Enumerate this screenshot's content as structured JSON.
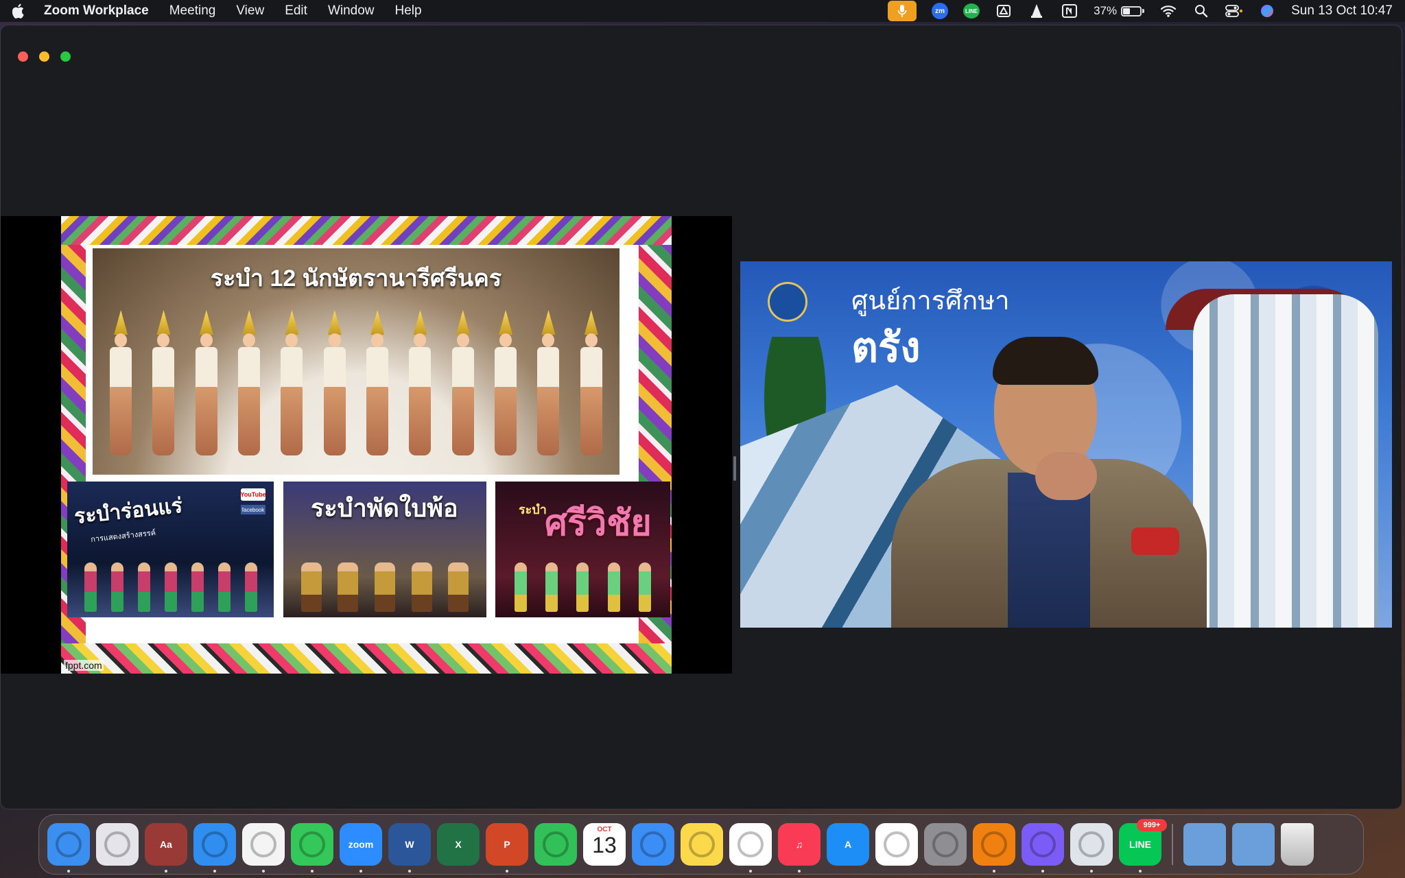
{
  "menubar": {
    "app_name": "Zoom Workplace",
    "menus": [
      "Meeting",
      "View",
      "Edit",
      "Window",
      "Help"
    ],
    "status_icons": [
      "microphone-icon",
      "zoom-icon",
      "line-icon",
      "google-drive-icon",
      "vlc-icon",
      "notion-icon"
    ],
    "battery_percent": "37%",
    "battery_level": 0.37,
    "clock": "Sun 13 Oct  10:47"
  },
  "window": {
    "traffic_lights": [
      "close",
      "minimize",
      "zoom"
    ]
  },
  "shared_screen": {
    "slide_title": "ระบำ 12 นักษัตรานารีศรีนคร",
    "thumbnails": [
      {
        "title": "ระบำร่อนแร่",
        "subtitle": "การแสดงสร้างสรรค์",
        "badges": [
          "YouTube",
          "facebook"
        ]
      },
      {
        "title": "ระบำพัดใบพ้อ"
      },
      {
        "pre": "ระบำ",
        "title": "ศรีวิชัย"
      }
    ],
    "credit": "fppt.com"
  },
  "video": {
    "heading": "ศูนย์การศึกษา",
    "heading2": "ตรัง"
  },
  "dock": {
    "apps": [
      {
        "name": "Finder",
        "icon": "finder-icon",
        "running": true,
        "color": "#3b8ff0"
      },
      {
        "name": "Launchpad",
        "icon": "launchpad-icon",
        "running": false,
        "color": "#e4e4ea"
      },
      {
        "name": "Dictionary",
        "icon": "dictionary-icon",
        "running": true,
        "color": "#9a3a36",
        "label": "Aa"
      },
      {
        "name": "Safari",
        "icon": "safari-icon",
        "running": true,
        "color": "#2f8ef0"
      },
      {
        "name": "Chrome",
        "icon": "chrome-icon",
        "running": true,
        "color": "#f4f4f4"
      },
      {
        "name": "Messages",
        "icon": "messages-icon",
        "running": true,
        "color": "#34c759"
      },
      {
        "name": "Zoom",
        "icon": "zoom-app-icon",
        "running": true,
        "color": "#2d8cff",
        "label": "zoom"
      },
      {
        "name": "Word",
        "icon": "word-icon",
        "running": true,
        "color": "#2b579a",
        "label": "W"
      },
      {
        "name": "Excel",
        "icon": "excel-icon",
        "running": false,
        "color": "#217346",
        "label": "X"
      },
      {
        "name": "PowerPoint",
        "icon": "powerpoint-icon",
        "running": true,
        "color": "#d24726",
        "label": "P"
      },
      {
        "name": "FaceTime",
        "icon": "facetime-icon",
        "running": false,
        "color": "#32c059"
      },
      {
        "name": "Calendar",
        "icon": "calendar-icon",
        "running": false,
        "color": "#ffffff",
        "month": "OCT",
        "day": "13"
      },
      {
        "name": "Mail",
        "icon": "mail-icon",
        "running": false,
        "color": "#3a8ef6"
      },
      {
        "name": "Notes",
        "icon": "notes-icon",
        "running": false,
        "color": "#fbd94a"
      },
      {
        "name": "Freeform",
        "icon": "freeform-icon",
        "running": true,
        "color": "#ffffff"
      },
      {
        "name": "Music",
        "icon": "music-icon",
        "running": true,
        "color": "#fa3b55",
        "label": "♫"
      },
      {
        "name": "App Store",
        "icon": "appstore-icon",
        "running": false,
        "color": "#1c8ef5",
        "label": "A"
      },
      {
        "name": "Google Drive",
        "icon": "google-drive-icon",
        "running": false,
        "color": "#ffffff"
      },
      {
        "name": "System Settings",
        "icon": "settings-icon",
        "running": false,
        "color": "#8e8e93"
      },
      {
        "name": "VLC",
        "icon": "vlc-icon",
        "running": true,
        "color": "#f08010"
      },
      {
        "name": "Messenger",
        "icon": "messenger-icon",
        "running": true,
        "color": "#7b5cf6"
      },
      {
        "name": "Blank App",
        "icon": "app-grid-icon",
        "running": true,
        "color": "#dfe3ea"
      },
      {
        "name": "LINE",
        "icon": "line-icon",
        "running": true,
        "color": "#06c755",
        "label": "LINE",
        "badge": "999+"
      }
    ],
    "folders": [
      {
        "name": "Applications",
        "icon": "applications-folder-icon",
        "color": "#6a9fdc"
      },
      {
        "name": "Downloads",
        "icon": "downloads-folder-icon",
        "color": "#6a9fdc"
      }
    ],
    "trash": {
      "name": "Trash",
      "icon": "trash-icon"
    }
  }
}
